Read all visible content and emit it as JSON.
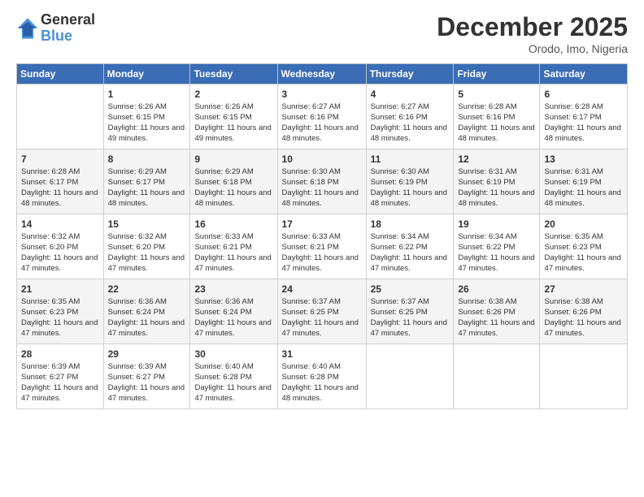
{
  "logo": {
    "general": "General",
    "blue": "Blue"
  },
  "title": "December 2025",
  "location": "Orodo, Imo, Nigeria",
  "days_header": [
    "Sunday",
    "Monday",
    "Tuesday",
    "Wednesday",
    "Thursday",
    "Friday",
    "Saturday"
  ],
  "weeks": [
    [
      {
        "day": "",
        "sunrise": "",
        "sunset": "",
        "daylight": ""
      },
      {
        "day": "1",
        "sunrise": "Sunrise: 6:26 AM",
        "sunset": "Sunset: 6:15 PM",
        "daylight": "Daylight: 11 hours and 49 minutes."
      },
      {
        "day": "2",
        "sunrise": "Sunrise: 6:26 AM",
        "sunset": "Sunset: 6:15 PM",
        "daylight": "Daylight: 11 hours and 49 minutes."
      },
      {
        "day": "3",
        "sunrise": "Sunrise: 6:27 AM",
        "sunset": "Sunset: 6:16 PM",
        "daylight": "Daylight: 11 hours and 48 minutes."
      },
      {
        "day": "4",
        "sunrise": "Sunrise: 6:27 AM",
        "sunset": "Sunset: 6:16 PM",
        "daylight": "Daylight: 11 hours and 48 minutes."
      },
      {
        "day": "5",
        "sunrise": "Sunrise: 6:28 AM",
        "sunset": "Sunset: 6:16 PM",
        "daylight": "Daylight: 11 hours and 48 minutes."
      },
      {
        "day": "6",
        "sunrise": "Sunrise: 6:28 AM",
        "sunset": "Sunset: 6:17 PM",
        "daylight": "Daylight: 11 hours and 48 minutes."
      }
    ],
    [
      {
        "day": "7",
        "sunrise": "Sunrise: 6:28 AM",
        "sunset": "Sunset: 6:17 PM",
        "daylight": "Daylight: 11 hours and 48 minutes."
      },
      {
        "day": "8",
        "sunrise": "Sunrise: 6:29 AM",
        "sunset": "Sunset: 6:17 PM",
        "daylight": "Daylight: 11 hours and 48 minutes."
      },
      {
        "day": "9",
        "sunrise": "Sunrise: 6:29 AM",
        "sunset": "Sunset: 6:18 PM",
        "daylight": "Daylight: 11 hours and 48 minutes."
      },
      {
        "day": "10",
        "sunrise": "Sunrise: 6:30 AM",
        "sunset": "Sunset: 6:18 PM",
        "daylight": "Daylight: 11 hours and 48 minutes."
      },
      {
        "day": "11",
        "sunrise": "Sunrise: 6:30 AM",
        "sunset": "Sunset: 6:19 PM",
        "daylight": "Daylight: 11 hours and 48 minutes."
      },
      {
        "day": "12",
        "sunrise": "Sunrise: 6:31 AM",
        "sunset": "Sunset: 6:19 PM",
        "daylight": "Daylight: 11 hours and 48 minutes."
      },
      {
        "day": "13",
        "sunrise": "Sunrise: 6:31 AM",
        "sunset": "Sunset: 6:19 PM",
        "daylight": "Daylight: 11 hours and 48 minutes."
      }
    ],
    [
      {
        "day": "14",
        "sunrise": "Sunrise: 6:32 AM",
        "sunset": "Sunset: 6:20 PM",
        "daylight": "Daylight: 11 hours and 47 minutes."
      },
      {
        "day": "15",
        "sunrise": "Sunrise: 6:32 AM",
        "sunset": "Sunset: 6:20 PM",
        "daylight": "Daylight: 11 hours and 47 minutes."
      },
      {
        "day": "16",
        "sunrise": "Sunrise: 6:33 AM",
        "sunset": "Sunset: 6:21 PM",
        "daylight": "Daylight: 11 hours and 47 minutes."
      },
      {
        "day": "17",
        "sunrise": "Sunrise: 6:33 AM",
        "sunset": "Sunset: 6:21 PM",
        "daylight": "Daylight: 11 hours and 47 minutes."
      },
      {
        "day": "18",
        "sunrise": "Sunrise: 6:34 AM",
        "sunset": "Sunset: 6:22 PM",
        "daylight": "Daylight: 11 hours and 47 minutes."
      },
      {
        "day": "19",
        "sunrise": "Sunrise: 6:34 AM",
        "sunset": "Sunset: 6:22 PM",
        "daylight": "Daylight: 11 hours and 47 minutes."
      },
      {
        "day": "20",
        "sunrise": "Sunrise: 6:35 AM",
        "sunset": "Sunset: 6:23 PM",
        "daylight": "Daylight: 11 hours and 47 minutes."
      }
    ],
    [
      {
        "day": "21",
        "sunrise": "Sunrise: 6:35 AM",
        "sunset": "Sunset: 6:23 PM",
        "daylight": "Daylight: 11 hours and 47 minutes."
      },
      {
        "day": "22",
        "sunrise": "Sunrise: 6:36 AM",
        "sunset": "Sunset: 6:24 PM",
        "daylight": "Daylight: 11 hours and 47 minutes."
      },
      {
        "day": "23",
        "sunrise": "Sunrise: 6:36 AM",
        "sunset": "Sunset: 6:24 PM",
        "daylight": "Daylight: 11 hours and 47 minutes."
      },
      {
        "day": "24",
        "sunrise": "Sunrise: 6:37 AM",
        "sunset": "Sunset: 6:25 PM",
        "daylight": "Daylight: 11 hours and 47 minutes."
      },
      {
        "day": "25",
        "sunrise": "Sunrise: 6:37 AM",
        "sunset": "Sunset: 6:25 PM",
        "daylight": "Daylight: 11 hours and 47 minutes."
      },
      {
        "day": "26",
        "sunrise": "Sunrise: 6:38 AM",
        "sunset": "Sunset: 6:26 PM",
        "daylight": "Daylight: 11 hours and 47 minutes."
      },
      {
        "day": "27",
        "sunrise": "Sunrise: 6:38 AM",
        "sunset": "Sunset: 6:26 PM",
        "daylight": "Daylight: 11 hours and 47 minutes."
      }
    ],
    [
      {
        "day": "28",
        "sunrise": "Sunrise: 6:39 AM",
        "sunset": "Sunset: 6:27 PM",
        "daylight": "Daylight: 11 hours and 47 minutes."
      },
      {
        "day": "29",
        "sunrise": "Sunrise: 6:39 AM",
        "sunset": "Sunset: 6:27 PM",
        "daylight": "Daylight: 11 hours and 47 minutes."
      },
      {
        "day": "30",
        "sunrise": "Sunrise: 6:40 AM",
        "sunset": "Sunset: 6:28 PM",
        "daylight": "Daylight: 11 hours and 47 minutes."
      },
      {
        "day": "31",
        "sunrise": "Sunrise: 6:40 AM",
        "sunset": "Sunset: 6:28 PM",
        "daylight": "Daylight: 11 hours and 48 minutes."
      },
      {
        "day": "",
        "sunrise": "",
        "sunset": "",
        "daylight": ""
      },
      {
        "day": "",
        "sunrise": "",
        "sunset": "",
        "daylight": ""
      },
      {
        "day": "",
        "sunrise": "",
        "sunset": "",
        "daylight": ""
      }
    ]
  ]
}
